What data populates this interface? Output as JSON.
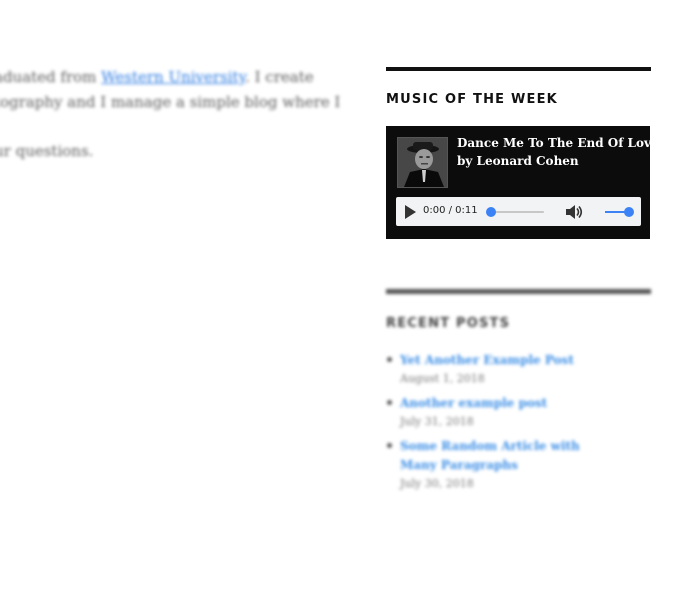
{
  "article": {
    "line1_pre": "aduated from ",
    "line1_link": "Western University",
    "line1_post": ". I create",
    "line2": "tography and I manage a simple blog where I",
    "line3": "ur questions."
  },
  "music_widget": {
    "title": "MUSIC OF THE WEEK",
    "track_title": "Dance Me To The End Of Love",
    "track_artist": "by Leonard Cohen",
    "player": {
      "time": "0:00 / 0:11",
      "progress_fraction": 0.0,
      "volume_fraction": 1.0,
      "accent_color": "#3b82f6"
    }
  },
  "recent_posts": {
    "title": "RECENT POSTS",
    "items": [
      {
        "title": "Yet Another Example Post",
        "date": "August 1, 2018"
      },
      {
        "title": "Another example post",
        "date": "July 31, 2018"
      },
      {
        "title": "Some Random Article with Many Paragraphs",
        "date": "July 30, 2018"
      }
    ]
  },
  "icons": {
    "play": "play-icon",
    "volume": "volume-icon",
    "album": "album-art-image"
  }
}
